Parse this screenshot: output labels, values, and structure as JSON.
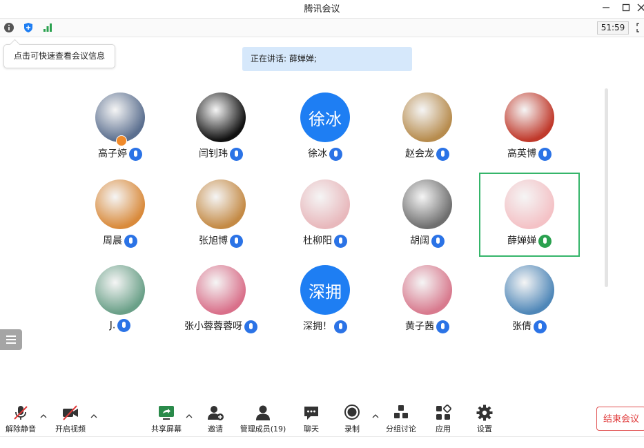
{
  "window": {
    "title": "腾讯会议"
  },
  "topbar": {
    "timer": "51:59"
  },
  "tooltip": {
    "text": "点击可快速查看会议信息"
  },
  "speaking": {
    "label": "正在讲话: 薛婵婵;"
  },
  "participants": [
    {
      "name": "高子婷",
      "avatar": "photo-scene",
      "avatar_color": "#5b6f8f",
      "mic": "on"
    },
    {
      "name": "闫钊玮",
      "avatar": "photo-sketch",
      "avatar_color": "#111111",
      "mic": "on"
    },
    {
      "name": "徐冰",
      "avatar_text": "徐冰",
      "avatar_color": "#1e7ef3",
      "mic": "on"
    },
    {
      "name": "赵会龙",
      "avatar": "photo-calligraphy",
      "avatar_color": "#b78c4e",
      "mic": "on"
    },
    {
      "name": "高英博",
      "avatar": "photo-cat-flag",
      "avatar_color": "#c0392b",
      "mic": "on"
    },
    {
      "name": "周晨",
      "avatar": "photo-colorful",
      "avatar_color": "#d98a3b",
      "mic": "on"
    },
    {
      "name": "张旭博",
      "avatar": "photo-bear",
      "avatar_color": "#c48a45",
      "mic": "on"
    },
    {
      "name": "杜柳阳",
      "avatar": "photo-girl-drawing",
      "avatar_color": "#e8b8bc",
      "mic": "on"
    },
    {
      "name": "胡阔",
      "avatar": "photo-dog-bw",
      "avatar_color": "#6f6f6f",
      "mic": "on"
    },
    {
      "name": "薛婵婵",
      "avatar": "photo-cartoon-girl",
      "avatar_color": "#f4c2c6",
      "mic": "speaking"
    },
    {
      "name": "J.",
      "avatar": "photo-leaf",
      "avatar_color": "#6aa088",
      "mic": "on"
    },
    {
      "name": "张小蓉蓉蓉呀",
      "avatar": "photo-girl-pink",
      "avatar_color": "#d9708a",
      "mic": "on"
    },
    {
      "name": "深拥！",
      "avatar_text": "深拥",
      "avatar_color": "#1e7ef3",
      "mic": "on"
    },
    {
      "name": "黄子茜",
      "avatar": "photo-child",
      "avatar_color": "#d87a8e",
      "mic": "on"
    },
    {
      "name": "张倩",
      "avatar": "photo-sea",
      "avatar_color": "#4f87b8",
      "mic": "on"
    }
  ],
  "toolbar": {
    "unmute": "解除静音",
    "start_video": "开启视频",
    "share_screen": "共享屏幕",
    "invite": "邀请",
    "manage_members": "管理成员(19)",
    "chat": "聊天",
    "record": "录制",
    "breakout": "分组讨论",
    "apps": "应用",
    "settings": "设置",
    "end_meeting": "结束会议"
  }
}
